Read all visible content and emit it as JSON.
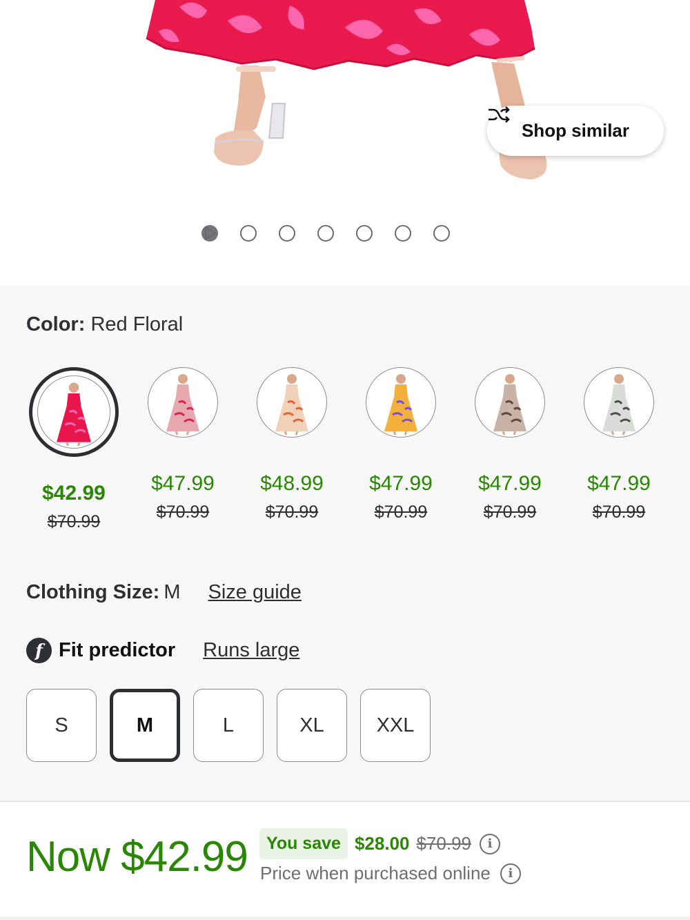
{
  "hero": {
    "shop_similar_label": "Shop similar",
    "shop_similar_icon": "shuffle-icon",
    "carousel_count": 7,
    "carousel_active_index": 0,
    "next_icon": "play-arrow-icon"
  },
  "color": {
    "label": "Color:",
    "value": "Red Floral"
  },
  "swatches": [
    {
      "price": "$42.99",
      "was": "$70.99",
      "selected": true,
      "dress_color": "#e8164b",
      "accent": "#ff66b0"
    },
    {
      "price": "$47.99",
      "was": "$70.99",
      "selected": false,
      "dress_color": "#e8a8b0",
      "accent": "#d82650"
    },
    {
      "price": "$48.99",
      "was": "$70.99",
      "selected": false,
      "dress_color": "#f1d2b8",
      "accent": "#e0663a"
    },
    {
      "price": "$47.99",
      "was": "$70.99",
      "selected": false,
      "dress_color": "#f3b03a",
      "accent": "#7a4fd6"
    },
    {
      "price": "$47.99",
      "was": "$70.99",
      "selected": false,
      "dress_color": "#c9b3a6",
      "accent": "#5c4a40"
    },
    {
      "price": "$47.99",
      "was": "$70.99",
      "selected": false,
      "dress_color": "#d9dcd8",
      "accent": "#4a5148"
    }
  ],
  "size": {
    "label": "Clothing Size:",
    "value": "M",
    "guide_link": "Size guide"
  },
  "fit": {
    "icon_letter": "f",
    "label": "Fit predictor",
    "result_link": "Runs large"
  },
  "size_options": [
    {
      "label": "S",
      "selected": false
    },
    {
      "label": "M",
      "selected": true
    },
    {
      "label": "L",
      "selected": false
    },
    {
      "label": "XL",
      "selected": false
    },
    {
      "label": "XXL",
      "selected": false
    }
  ],
  "price": {
    "now": "Now $42.99",
    "you_save_label": "You save",
    "save_amount": "$28.00",
    "was": "$70.99",
    "online_note": "Price when purchased online",
    "info_glyph": "i"
  },
  "colors": {
    "green": "#2a8703",
    "text": "#2e2f32",
    "panel_bg": "#f7f7f7"
  }
}
